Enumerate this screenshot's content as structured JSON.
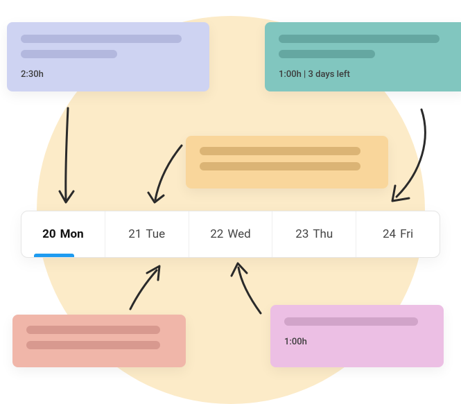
{
  "cards": {
    "purple": {
      "meta": "2:30h"
    },
    "teal": {
      "meta": "1:00h | 3 days left"
    },
    "orange": {
      "meta": ""
    },
    "coral": {
      "meta": ""
    },
    "pink": {
      "meta": "1:00h"
    }
  },
  "week": {
    "days": [
      {
        "num": "20",
        "abbr": "Mon",
        "selected": true
      },
      {
        "num": "21",
        "abbr": "Tue",
        "selected": false
      },
      {
        "num": "22",
        "abbr": "Wed",
        "selected": false
      },
      {
        "num": "23",
        "abbr": "Thu",
        "selected": false
      },
      {
        "num": "24",
        "abbr": "Fri",
        "selected": false
      }
    ]
  }
}
